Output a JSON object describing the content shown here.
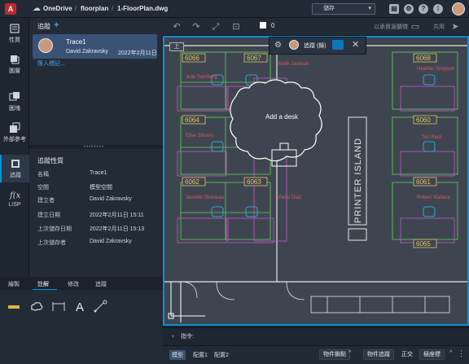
{
  "topbar": {
    "logo": "A",
    "breadcrumb": [
      "OneDrive",
      "floorplan",
      "1-FloorPlan.dwg"
    ],
    "save_label": "儲存"
  },
  "rail": {
    "items": [
      {
        "label": "性質",
        "icon": "properties-icon"
      },
      {
        "label": "圖層",
        "icon": "layers-icon"
      },
      {
        "label": "圖塊",
        "icon": "blocks-icon"
      },
      {
        "label": "外部參考",
        "icon": "xref-icon"
      },
      {
        "label": "追蹤",
        "icon": "trace-icon",
        "active": true
      },
      {
        "label": "LISP",
        "icon": "lisp-icon"
      }
    ]
  },
  "trace_panel": {
    "title": "追蹤",
    "add": "+",
    "trace": {
      "name": "Trace1",
      "author": "David Zakravsky",
      "date": "2022年2月11日"
    },
    "add_tag": "匯入標記..."
  },
  "properties": {
    "title": "追蹤性質",
    "rows": [
      {
        "key": "名稱",
        "value": "Trace1"
      },
      {
        "key": "空間",
        "value": "模型空間"
      },
      {
        "key": "建立者",
        "value": "David Zakravsky"
      },
      {
        "key": "建立日期",
        "value": "2022年2月11日 15:11"
      },
      {
        "key": "上次儲存日期",
        "value": "2022年2月11日 15:13"
      },
      {
        "key": "上次儲存者",
        "value": "David Zakravsky"
      }
    ]
  },
  "tools": {
    "tabs": [
      {
        "label": "繪製"
      },
      {
        "label": "註解",
        "active": true
      },
      {
        "label": "修改"
      },
      {
        "label": "追蹤"
      }
    ],
    "icons": [
      "highlighter-icon",
      "cloud-markup-icon",
      "dimension-icon",
      "text-icon",
      "leader-icon"
    ],
    "text_glyph": "A"
  },
  "canvas_toolbar": {
    "layer": "0",
    "share_label": "以承資源擴徵",
    "share_button": "共用"
  },
  "drawing": {
    "viewport_label": "上",
    "room_tags": [
      "6066",
      "6067",
      "6068",
      "6064",
      "6063",
      "6062",
      "6061",
      "6060",
      "6065"
    ],
    "names": [
      "Julie Samberg",
      "Keith Jackson",
      "Heather Simpson",
      "Elise Shiraro",
      "Jennifer Sheneau",
      "Peter Diaz",
      "Robert Wallace",
      "Teri Ried"
    ],
    "island_label": "PRINTER ISLAND",
    "cloud_text": "Add a desk"
  },
  "trace_popup": {
    "title": "追蹤 (錄)"
  },
  "command": {
    "chevron": "›",
    "label": "指令:"
  },
  "status": {
    "tabs": [
      {
        "label": "模型",
        "active": true
      },
      {
        "label": "配置1"
      },
      {
        "label": "配置2"
      }
    ],
    "buttons": [
      "物件鎖點",
      "物件追蹤",
      "正交",
      "極座標"
    ]
  },
  "colors": {
    "accent": "#0696d7",
    "panel": "#232b37",
    "canvas": "#3e4550",
    "selection": "#3a5276"
  }
}
